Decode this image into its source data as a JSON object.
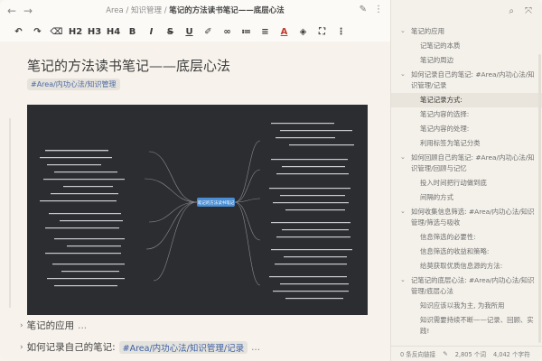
{
  "titlebar": {
    "back": "←",
    "forward": "→",
    "crumb_path": "Area / 知识管理 /",
    "crumb_current": "笔记的方法读书笔记——底层心法"
  },
  "toolbar": {
    "items": [
      "undo-icon",
      "redo-icon",
      "eraser-icon",
      "H2",
      "H3",
      "H4",
      "B",
      "I",
      "S",
      "U",
      "pen-icon",
      "link-icon",
      "list-icon",
      "align-icon",
      "A",
      "highlight-icon",
      "expand-icon",
      "more-icon"
    ]
  },
  "doc": {
    "title": "笔记的方法读书笔记——底层心法",
    "tag": "#Area/内功心法/知识管理",
    "sections": [
      {
        "label": "笔记的应用",
        "ellipsis": "...",
        "tag": ""
      },
      {
        "label": "如何记录自己的笔记:",
        "ellipsis": "...",
        "tag": "#Area/内功心法/知识管理/记录"
      }
    ]
  },
  "mindmap": {
    "center_label": "笔记的方法读书笔记"
  },
  "outline": {
    "items": [
      {
        "text": "笔记的应用",
        "level": 1,
        "chev": true
      },
      {
        "text": "记笔记的本质",
        "level": 2
      },
      {
        "text": "笔记的周边",
        "level": 2
      },
      {
        "text": "如何记录自己的笔记: #Area/内功心法/知识管理/记录",
        "level": 1,
        "chev": true
      },
      {
        "text": "笔记记录方式:",
        "level": 2,
        "active": true
      },
      {
        "text": "笔记内容的选择:",
        "level": 2
      },
      {
        "text": "笔记内容的处理:",
        "level": 2
      },
      {
        "text": "利用标签为笔记分类",
        "level": 2
      },
      {
        "text": "如何回顾自己的笔记: #Area/内功心法/知识管理/回顾与记忆",
        "level": 1,
        "chev": true
      },
      {
        "text": "投入时间把行动做到底",
        "level": 2
      },
      {
        "text": "间隔的方式",
        "level": 2
      },
      {
        "text": "如何收集信息筛选: #Area/内功心法/知识管理/筛选与吸收",
        "level": 1,
        "chev": true
      },
      {
        "text": "信息筛选的必要性:",
        "level": 2
      },
      {
        "text": "信息筛选的收益和策略:",
        "level": 2
      },
      {
        "text": "给莫获取优质信息源的方法:",
        "level": 2
      },
      {
        "text": "记笔记的底层心法: #Area/内功心法/知识管理/底层心法",
        "level": 1,
        "chev": true
      },
      {
        "text": "知识应该以我为主, 为我所用",
        "level": 2
      },
      {
        "text": "知识需要持续不断——记录、回顾、实践!",
        "level": 2
      }
    ],
    "footer": {
      "backlinks": "0 条反向链接",
      "words": "2,805 个词",
      "chars": "4,042 个字符"
    }
  }
}
